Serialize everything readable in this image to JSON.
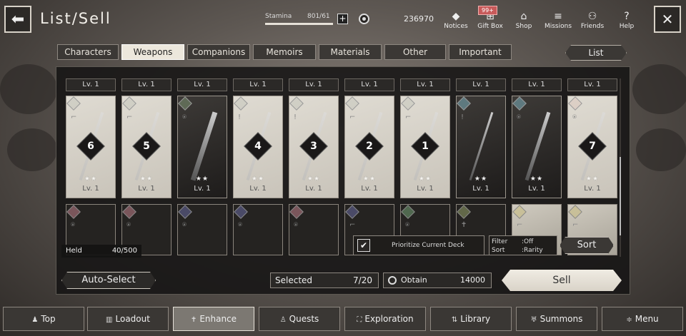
{
  "header": {
    "title": "List/Sell",
    "stamina_label": "Stamina",
    "stamina_value": "801/61",
    "stamina_fill": 1.0,
    "currency": "236970",
    "badge": "99+",
    "nav": [
      {
        "label": "Notices",
        "icon": "notices-icon",
        "glyph": "◆"
      },
      {
        "label": "Gift Box",
        "icon": "gift-box-icon",
        "glyph": "⊞"
      },
      {
        "label": "Shop",
        "icon": "shop-icon",
        "glyph": "⌂"
      },
      {
        "label": "Missions",
        "icon": "missions-icon",
        "glyph": "≡"
      },
      {
        "label": "Friends",
        "icon": "friends-icon",
        "glyph": "⚇"
      },
      {
        "label": "Help",
        "icon": "help-icon",
        "glyph": "?"
      }
    ]
  },
  "tabs": [
    "Characters",
    "Weapons",
    "Companions",
    "Memoirs",
    "Materials",
    "Other",
    "Important"
  ],
  "active_tab": "Weapons",
  "list_button": "List",
  "lv_top": [
    "Lv. 1",
    "Lv. 1",
    "Lv. 1",
    "Lv. 1",
    "Lv. 1",
    "Lv. 1",
    "Lv. 1",
    "Lv. 1",
    "Lv. 1",
    "Lv. 1"
  ],
  "cards": [
    {
      "style": "light",
      "number": "6",
      "stars": "★★",
      "level": "Lv. 1"
    },
    {
      "style": "light",
      "number": "5",
      "stars": "★★",
      "level": "Lv. 1"
    },
    {
      "style": "dark",
      "number": "",
      "stars": "★★",
      "level": "Lv. 1"
    },
    {
      "style": "light",
      "number": "4",
      "stars": "★★",
      "level": "Lv. 1"
    },
    {
      "style": "light",
      "number": "3",
      "stars": "★★",
      "level": "Lv. 1"
    },
    {
      "style": "light",
      "number": "2",
      "stars": "★★",
      "level": "Lv. 1"
    },
    {
      "style": "light",
      "number": "1",
      "stars": "★★",
      "level": "Lv. 1"
    },
    {
      "style": "dark",
      "number": "",
      "stars": "★★",
      "level": "Lv. 1"
    },
    {
      "style": "dark",
      "number": "",
      "stars": "★★",
      "level": "Lv. 1"
    },
    {
      "style": "light",
      "number": "7",
      "stars": "★★",
      "level": "Lv. 1"
    }
  ],
  "held": {
    "label": "Held",
    "value": "40/500"
  },
  "prioritize": "Prioritize Current Deck",
  "filter": {
    "filter_label": "Filter",
    "filter_value": ":Off",
    "sort_label": "Sort",
    "sort_value": ":Rarity"
  },
  "sort_button": "Sort",
  "auto_select": "Auto-Select",
  "selected": {
    "label": "Selected",
    "value": "7/20"
  },
  "obtain": {
    "label": "Obtain",
    "value": "14000"
  },
  "sell": "Sell",
  "bottom_nav": [
    {
      "label": "Top",
      "glyph": "♟"
    },
    {
      "label": "Loadout",
      "glyph": "▥"
    },
    {
      "label": "Enhance",
      "glyph": "✝"
    },
    {
      "label": "Quests",
      "glyph": "♙"
    },
    {
      "label": "Exploration",
      "glyph": "⛶"
    },
    {
      "label": "Library",
      "glyph": "⇅"
    },
    {
      "label": "Summons",
      "glyph": "♅"
    },
    {
      "label": "Menu",
      "glyph": "≑"
    }
  ],
  "active_nav": "Enhance"
}
